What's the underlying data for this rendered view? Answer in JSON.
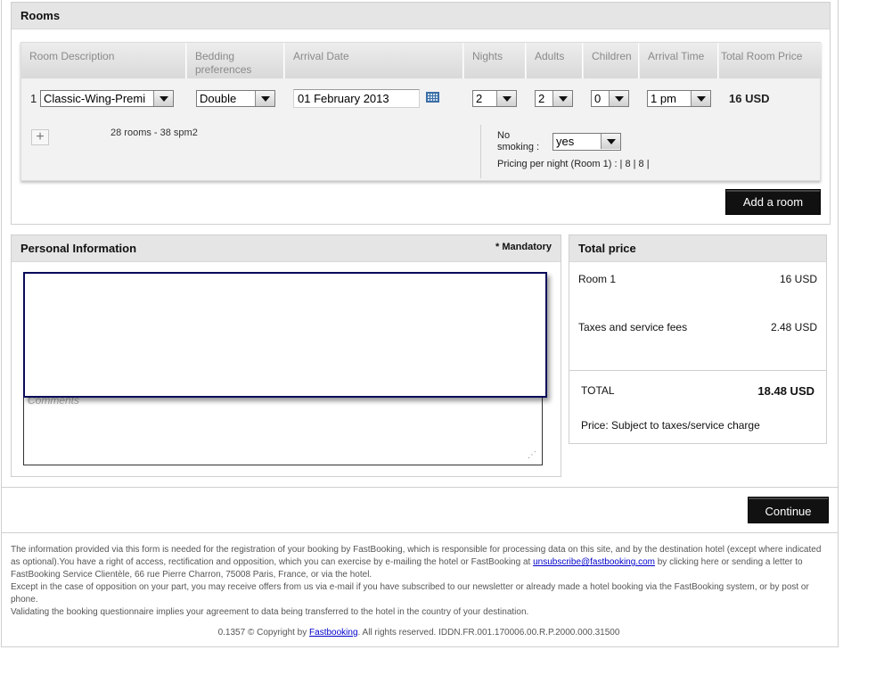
{
  "rooms": {
    "title": "Rooms",
    "headers": {
      "room_description": "Room Description",
      "bedding": "Bedding preferences",
      "arrival_date": "Arrival Date",
      "nights": "Nights",
      "adults": "Adults",
      "children": "Children",
      "arrival_time": "Arrival Time",
      "total_room_price": "Total Room Price"
    },
    "row": {
      "index": "1",
      "room": "Classic-Wing-Premi",
      "bedding": "Double",
      "arrival_date": "01 February 2013",
      "nights": "2",
      "adults": "2",
      "children": "0",
      "arrival_time": "1 pm",
      "price": "16 USD",
      "details": "28 rooms - 38 spm2",
      "no_smoking_label": "No smoking :",
      "no_smoking_value": "yes",
      "pricing_per_night": "Pricing per night (Room 1) : | 8 | 8 |"
    },
    "add_room_label": "Add a room"
  },
  "personal_info": {
    "title": "Personal Information",
    "mandatory": "* Mandatory",
    "comments_placeholder": "Comments"
  },
  "total_price": {
    "title": "Total price",
    "room_label": "Room 1",
    "room_value": "16 USD",
    "taxes_label": "Taxes and service fees",
    "taxes_value": "2.48 USD",
    "total_label": "TOTAL",
    "total_value": "18.48 USD",
    "note": "Price: Subject to taxes/service charge"
  },
  "continue_label": "Continue",
  "footer": {
    "para1_a": "The information provided via this form is needed for the registration of your booking by FastBooking, which is responsible for processing data on this site, and by the destination hotel (except where indicated as optional).You have a right of access, rectification and opposition, which you can exercise by e-mailing the hotel or FastBooking at ",
    "email": "unsubscribe@fastbooking.com",
    "para1_b": " by clicking here or sending a letter to FastBooking Service Clientèle, 66 rue Pierre Charron, 75008 Paris, France, or via the hotel.",
    "para2": "Except in the case of opposition on your part, you may receive offers from us via e-mail if you have subscribed to our newsletter or already made a hotel booking via the FastBooking system, or by post or phone.",
    "para3": "Validating the booking questionnaire implies your agreement to data being transferred to the hotel in the country of your destination.",
    "copyright_a": "0.1357 © Copyright by ",
    "copyright_link": "Fastbooking",
    "copyright_b": ". All rights reserved. IDDN.FR.001.170006.00.R.P.2000.000.31500"
  }
}
